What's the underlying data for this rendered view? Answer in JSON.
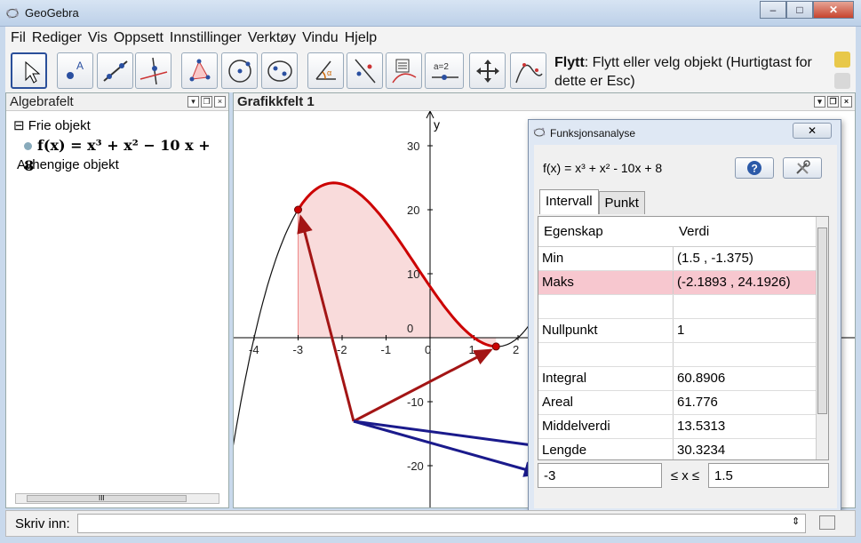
{
  "window": {
    "title": "GeoGebra",
    "controls": [
      "–",
      "□",
      "✕"
    ]
  },
  "menu": [
    "Fil",
    "Rediger",
    "Vis",
    "Oppsett",
    "Innstillinger",
    "Verktøy",
    "Vindu",
    "Hjelp"
  ],
  "toolbar": {
    "active_tool_name": "Flytt",
    "active_tool_desc": ": Flytt eller velg objekt (Hurtigtast for dette er Esc)",
    "move_tool_label": "a=2"
  },
  "algebra": {
    "title": "Algebrafelt",
    "free_header": "Frie objekt",
    "function": "f(x) = x³ + x² − 10 x + 8",
    "dependent_header": "Avhengige objekt",
    "scroll_label": "III"
  },
  "graphics": {
    "title": "Grafikkfelt 1",
    "axis_label_y": "y",
    "x_ticks": [
      "-4",
      "-3",
      "-2",
      "-1",
      "0",
      "1",
      "2"
    ],
    "y_ticks": [
      "30",
      "20",
      "10",
      "0",
      "-10",
      "-20"
    ]
  },
  "dialog": {
    "title": "Funksjonsanalyse",
    "close_label": "✕",
    "function_text": "f(x) = x³ + x² - 10x + 8",
    "tabs": [
      "Intervall",
      "Punkt"
    ],
    "headers": [
      "Egenskap",
      "Verdi"
    ],
    "rows": [
      {
        "prop": "Min",
        "value": "(1.5 , -1.375)"
      },
      {
        "prop": "Maks",
        "value": "(-2.1893 , 24.1926)"
      },
      {
        "prop": "",
        "value": ""
      },
      {
        "prop": "Nullpunkt",
        "value": "1"
      },
      {
        "prop": "",
        "value": ""
      },
      {
        "prop": "Integral",
        "value": "60.8906"
      },
      {
        "prop": "Areal",
        "value": "61.776"
      },
      {
        "prop": "Middelverdi",
        "value": "13.5313"
      },
      {
        "prop": "Lengde",
        "value": "30.3234"
      }
    ],
    "interval_from": "-3",
    "interval_symbol": "≤ x ≤",
    "interval_to": "1.5"
  },
  "input_bar": {
    "label": "Skriv inn:"
  },
  "colors": {
    "curve": "#cc0000",
    "fill": "#f8d2d2",
    "arrow_red": "#a31515",
    "arrow_blue": "#1a1a8c",
    "highlight_row": "#f7c7cf"
  }
}
